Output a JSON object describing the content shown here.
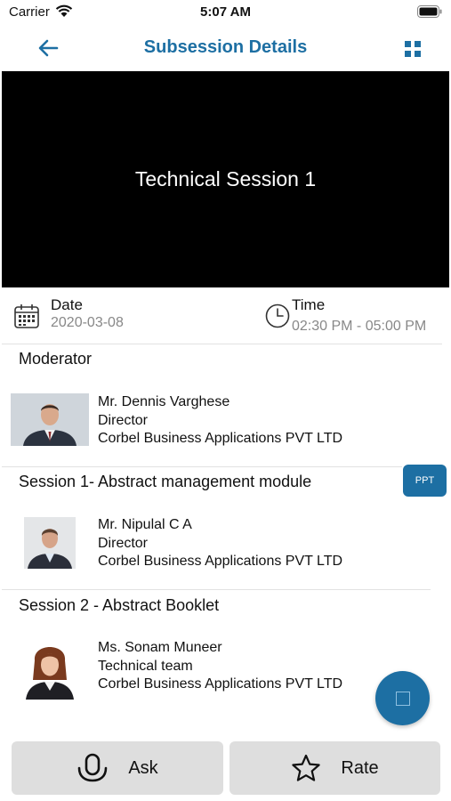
{
  "status_bar": {
    "carrier": "Carrier",
    "time": "5:07 AM"
  },
  "nav": {
    "title": "Subsession Details",
    "back_icon": "arrow-left-icon",
    "menu_icon": "grid-icon"
  },
  "banner": {
    "title": "Technical Session 1"
  },
  "date": {
    "label": "Date",
    "value": "2020-03-08"
  },
  "time": {
    "label": "Time",
    "value": "02:30 PM - 05:00 PM"
  },
  "sections": [
    {
      "title": "Moderator",
      "person": {
        "name": "Mr. Dennis Varghese",
        "role": "Director",
        "company": "Corbel Business Applications PVT LTD"
      }
    },
    {
      "title": "Session 1- Abstract management module",
      "badge": "PPT",
      "person": {
        "name": "Mr. Nipulal C A",
        "role": "Director",
        "company": "Corbel Business Applications PVT LTD"
      }
    },
    {
      "title": "Session 2 - Abstract Booklet",
      "person": {
        "name": "Ms. Sonam Muneer",
        "role": "Technical team",
        "company": "Corbel Business Applications PVT LTD"
      }
    }
  ],
  "actions": {
    "ask_label": "Ask",
    "rate_label": "Rate"
  },
  "colors": {
    "accent": "#1d6fa3",
    "button_bg": "#dedede"
  }
}
